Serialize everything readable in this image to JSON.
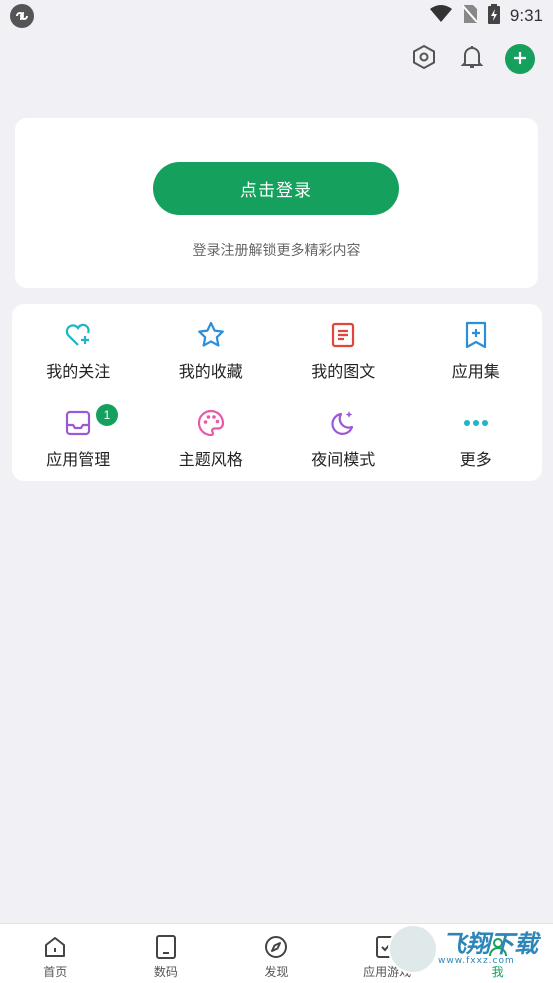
{
  "status_bar": {
    "time": "9:31"
  },
  "login": {
    "button_label": "点击登录",
    "hint": "登录注册解锁更多精彩内容"
  },
  "menu": {
    "items": [
      {
        "label": "我的关注",
        "icon": "heart-plus-icon",
        "color": "#1fb5c6"
      },
      {
        "label": "我的收藏",
        "icon": "star-icon",
        "color": "#2d8fd9"
      },
      {
        "label": "我的图文",
        "icon": "article-icon",
        "color": "#e0463c"
      },
      {
        "label": "应用集",
        "icon": "bookmark-plus-icon",
        "color": "#2d8fd9"
      },
      {
        "label": "应用管理",
        "icon": "inbox-icon",
        "color": "#9b59d6",
        "badge": "1"
      },
      {
        "label": "主题风格",
        "icon": "palette-icon",
        "color": "#e65aa8"
      },
      {
        "label": "夜间模式",
        "icon": "moon-stars-icon",
        "color": "#9b59d6"
      },
      {
        "label": "更多",
        "icon": "more-dots-icon",
        "color": "#1fb5c6"
      }
    ]
  },
  "bottom_nav": {
    "items": [
      {
        "label": "首页",
        "icon": "home-icon"
      },
      {
        "label": "数码",
        "icon": "tablet-icon"
      },
      {
        "label": "发现",
        "icon": "compass-icon"
      },
      {
        "label": "应用游戏",
        "icon": "apps-icon"
      },
      {
        "label": "我",
        "icon": "profile-icon",
        "active": true
      }
    ]
  },
  "watermark": {
    "title": "飞翔下载",
    "url": "www.fxxz.com"
  },
  "colors": {
    "accent": "#16a05d",
    "background": "#f1f0f5"
  }
}
